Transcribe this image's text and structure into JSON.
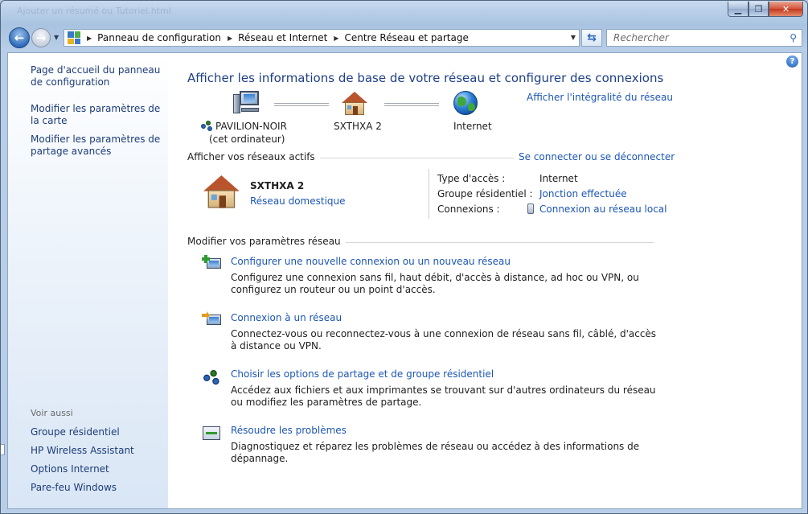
{
  "window": {
    "title_faded": "Ajouter un résumé ou Tutoriel.html"
  },
  "nav": {
    "breadcrumb": [
      "Panneau de configuration",
      "Réseau et Internet",
      "Centre Réseau et partage"
    ],
    "search_placeholder": "Rechercher"
  },
  "sidebar": {
    "links": [
      "Page d'accueil du panneau de configuration",
      "Modifier les paramètres de la carte",
      "Modifier les paramètres de partage avancés"
    ],
    "see_also_header": "Voir aussi",
    "see_also": [
      "Groupe résidentiel",
      "HP Wireless Assistant",
      "Options Internet",
      "Pare-feu Windows"
    ]
  },
  "main": {
    "title": "Afficher les informations de base de votre réseau et configurer des connexions",
    "view_full_map": "Afficher l'intégralité du réseau",
    "map": {
      "node1_name": "PAVILION-NOIR",
      "node1_sub": "(cet ordinateur)",
      "node2_name": "SXTHXA  2",
      "node3_name": "Internet"
    },
    "active_section": "Afficher vos réseaux actifs",
    "connect_link": "Se connecter ou se déconnecter",
    "network": {
      "name": "SXTHXA  2",
      "type_link": "Réseau domestique",
      "access_label": "Type d'accès :",
      "access_value": "Internet",
      "homegroup_label": "Groupe résidentiel :",
      "homegroup_value": "Jonction effectuée",
      "connections_label": "Connexions :",
      "connections_value": "Connexion au réseau local"
    },
    "settings_section": "Modifier vos paramètres réseau",
    "tasks": [
      {
        "title": "Configurer une nouvelle connexion ou un nouveau réseau",
        "desc": "Configurez une connexion sans fil, haut débit, d'accès à distance, ad hoc ou VPN, ou configurez un routeur ou un point d'accès."
      },
      {
        "title": "Connexion à un réseau",
        "desc": "Connectez-vous ou reconnectez-vous à une connexion de réseau sans fil, câblé, d'accès à distance ou VPN."
      },
      {
        "title": "Choisir les options de partage et de groupe résidentiel",
        "desc": "Accédez aux fichiers et aux imprimantes se trouvant sur d'autres ordinateurs du réseau ou modifiez les paramètres de partage."
      },
      {
        "title": "Résoudre les problèmes",
        "desc": "Diagnostiquez et réparez les problèmes de réseau ou accédez à des informations de dépannage."
      }
    ]
  },
  "colors": {
    "link": "#1c56b4",
    "title": "#1e3f86",
    "sidebar_link": "#1c3c78"
  }
}
